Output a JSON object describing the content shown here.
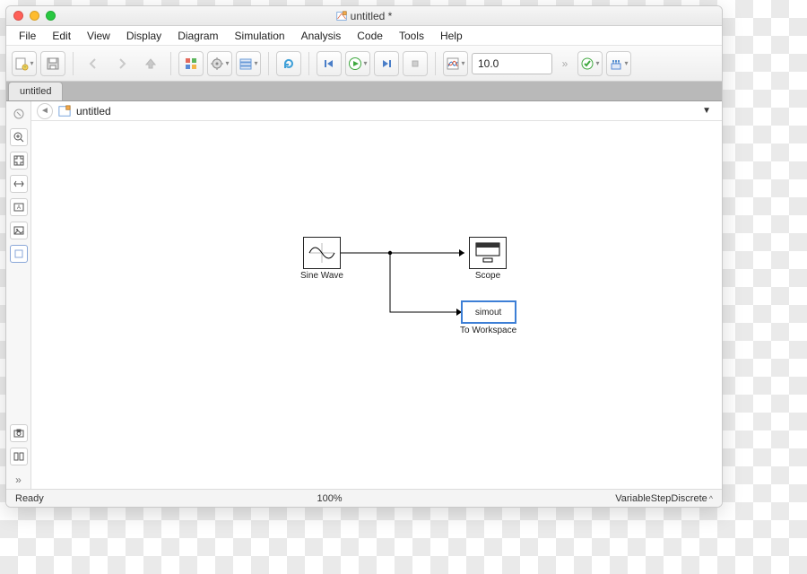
{
  "titlebar": {
    "title": "untitled *"
  },
  "menubar": {
    "items": [
      "File",
      "Edit",
      "View",
      "Display",
      "Diagram",
      "Simulation",
      "Analysis",
      "Code",
      "Tools",
      "Help"
    ]
  },
  "toolbar": {
    "stop_time": "10.0"
  },
  "tabstrip": {
    "active_tab": "untitled"
  },
  "breadcrumb": {
    "model_name": "untitled"
  },
  "blocks": {
    "sine": {
      "label": "Sine Wave"
    },
    "scope": {
      "label": "Scope"
    },
    "toworkspace": {
      "label": "To Workspace",
      "var": "simout"
    }
  },
  "statusbar": {
    "status": "Ready",
    "zoom": "100%",
    "solver": "VariableStepDiscrete"
  }
}
